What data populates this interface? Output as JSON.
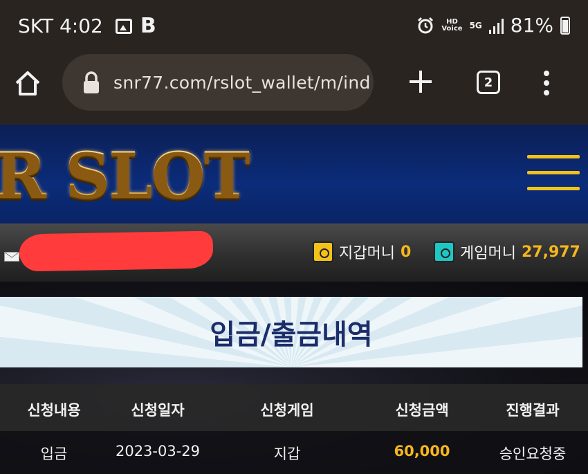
{
  "status_bar": {
    "carrier_time": "SKT 4:02",
    "b_badge": "B",
    "hd_voice_badge": "HD\nVoice",
    "fiveg_badge": "5G",
    "battery_percent": "81%"
  },
  "browser": {
    "url": "snr77.com/rslot_wallet/m/ind",
    "tab_count": "2"
  },
  "site": {
    "logo_text": "R SLOT"
  },
  "user_bar": {
    "wallet_label": "지갑머니",
    "wallet_value": "0",
    "game_label": "게임머니",
    "game_value": "27,977",
    "wallet_icon_color": "#f2c21a",
    "game_icon_color": "#1fc7c4"
  },
  "page": {
    "title": "입금/출금내역"
  },
  "table": {
    "headers": [
      "신청내용",
      "신청일자",
      "신청게임",
      "신청금액",
      "진행결과"
    ],
    "rows": [
      [
        "입금",
        "2023-03-29",
        "지갑",
        "60,000",
        "승인요청중"
      ]
    ]
  },
  "colors": {
    "accent_gold": "#f6b61e",
    "header_blue": "#0b2c7a",
    "title_navy": "#1c2d6b"
  }
}
